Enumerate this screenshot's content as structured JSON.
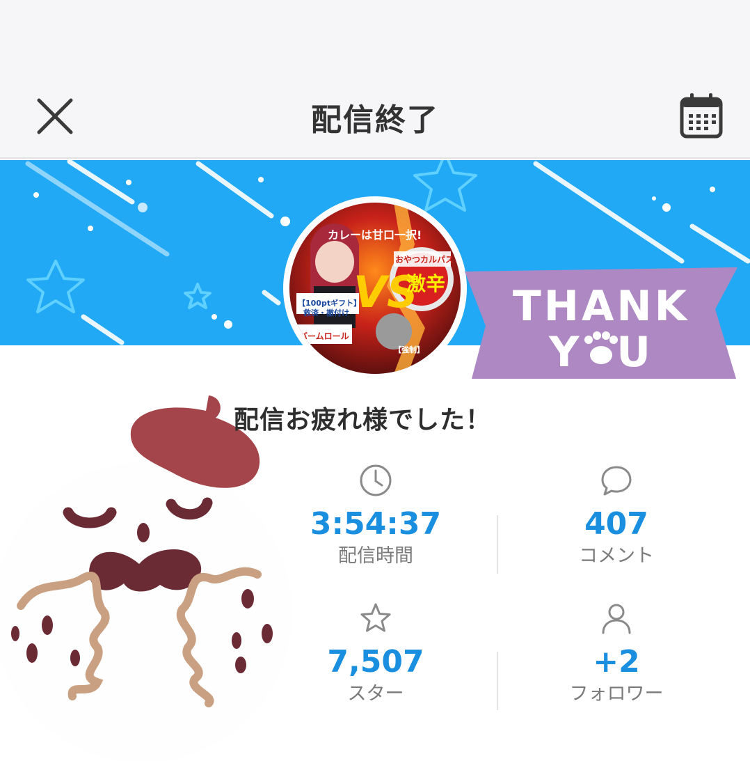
{
  "header": {
    "title": "配信終了",
    "close_icon": "close-icon",
    "calendar_icon": "calendar-icon",
    "background": "#f6f6f8"
  },
  "banner": {
    "background": "#21a9f5",
    "badge_text": "THANK YOU",
    "badge_color": "#b48fc8"
  },
  "thumbnail": {
    "texts": [
      "カレーは甘口一択!",
      "VS",
      "【100ptギフト】",
      "救済・撤付け",
      "バームロール",
      "おやつカルパス",
      "激辛",
      "【強制】"
    ]
  },
  "message": "配信お疲れ様でした！",
  "stats": [
    {
      "icon": "clock-icon",
      "value": "3:54:37",
      "label": "配信時間"
    },
    {
      "icon": "comment-icon",
      "value": "407",
      "label": "コメント"
    },
    {
      "icon": "star-icon",
      "value": "7,507",
      "label": "スター"
    },
    {
      "icon": "person-icon",
      "value": "+2",
      "label": "フォロワー"
    }
  ],
  "accent_color": "#1a8fe0"
}
